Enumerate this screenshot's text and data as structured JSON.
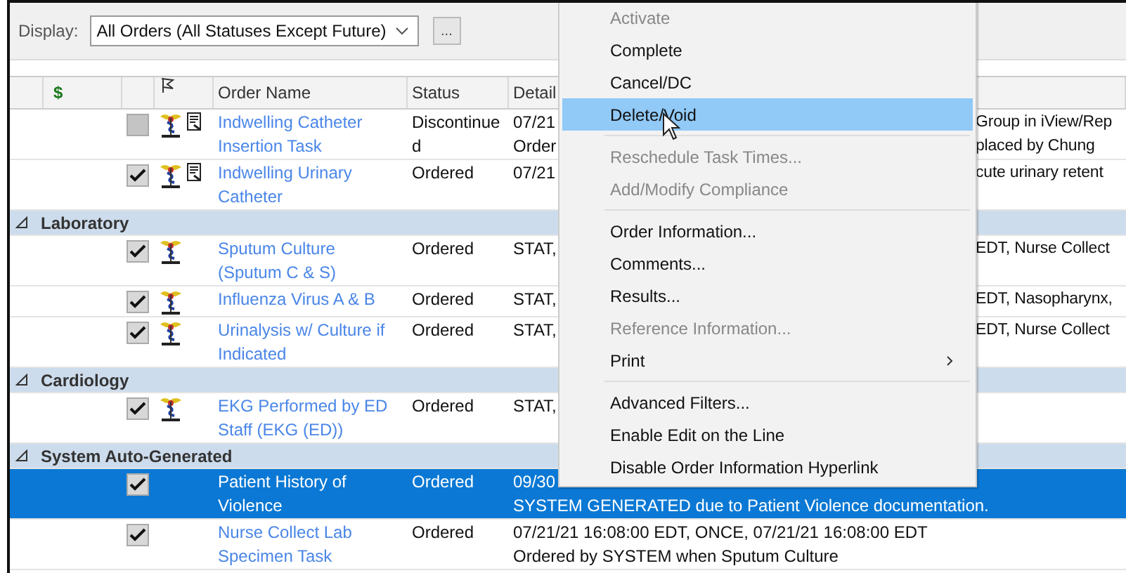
{
  "toolbar": {
    "label": "Display:",
    "dropdown": {
      "value": "All Orders (All Statuses Except Future)"
    },
    "more_button": "..."
  },
  "columns": [
    {
      "kind": "blank"
    },
    {
      "kind": "text",
      "label": "$"
    },
    {
      "kind": "blank"
    },
    {
      "kind": "flag"
    },
    {
      "kind": "text",
      "label": "Order Name"
    },
    {
      "kind": "text",
      "label": "Status"
    },
    {
      "kind": "text",
      "label": "Detail"
    }
  ],
  "rows": [
    {
      "kind": "order",
      "checked": false,
      "disabled": true,
      "caduceus": true,
      "note": true,
      "name": "Indwelling Catheter Insertion Task",
      "status": "Discontinued",
      "selected": false,
      "details": [
        {
          "left": "07/21",
          "right": "Group in iView/Rep"
        },
        {
          "left": "Order",
          "right": "placed by Chung"
        }
      ]
    },
    {
      "kind": "order",
      "checked": true,
      "disabled": false,
      "caduceus": true,
      "note": true,
      "name": "Indwelling Urinary Catheter",
      "status": "Ordered",
      "selected": false,
      "details": [
        {
          "left": "07/21",
          "right": "cute urinary retent"
        }
      ]
    },
    {
      "kind": "group",
      "label": "Laboratory",
      "expanded": true
    },
    {
      "kind": "order",
      "checked": true,
      "disabled": false,
      "caduceus": true,
      "note": false,
      "name": "Sputum Culture (Sputum C & S)",
      "status": "Ordered",
      "selected": false,
      "details": [
        {
          "left": "STAT,",
          "right": "EDT, Nurse Collect"
        }
      ]
    },
    {
      "kind": "order",
      "checked": true,
      "disabled": false,
      "caduceus": true,
      "note": false,
      "name": "Influenza Virus A & B",
      "status": "Ordered",
      "selected": false,
      "details": [
        {
          "left": "STAT,",
          "right": "EDT, Nasopharynx,"
        }
      ]
    },
    {
      "kind": "order",
      "checked": true,
      "disabled": false,
      "caduceus": true,
      "note": false,
      "name": "Urinalysis w/ Culture if Indicated",
      "status": "Ordered",
      "selected": false,
      "details": [
        {
          "left": "STAT,",
          "right": "EDT, Nurse Collect"
        }
      ]
    },
    {
      "kind": "group",
      "label": "Cardiology",
      "expanded": true
    },
    {
      "kind": "order",
      "checked": true,
      "disabled": false,
      "caduceus": true,
      "note": false,
      "name": "EKG Performed by ED Staff (EKG (ED))",
      "status": "Ordered",
      "selected": false,
      "details": [
        {
          "left": "STAT,"
        }
      ]
    },
    {
      "kind": "group",
      "label": "System Auto-Generated",
      "expanded": true
    },
    {
      "kind": "order",
      "checked": true,
      "disabled": false,
      "caduceus": false,
      "note": false,
      "name": "Patient History of Violence",
      "status": "Ordered",
      "selected": true,
      "details": [
        {
          "left": "09/30"
        },
        {
          "left": "SYSTEM GENERATED due to Patient Violence documentation."
        }
      ]
    },
    {
      "kind": "order",
      "checked": true,
      "disabled": false,
      "caduceus": false,
      "note": false,
      "name": "Nurse Collect Lab Specimen Task",
      "status": "Ordered",
      "selected": false,
      "details": [
        {
          "left": "07/21/21 16:08:00 EDT, ONCE, 07/21/21 16:08:00 EDT"
        },
        {
          "left": "Ordered by SYSTEM when Sputum Culture"
        }
      ]
    }
  ],
  "context_menu": [
    {
      "kind": "item",
      "label": "Activate",
      "disabled": true,
      "selected": false
    },
    {
      "kind": "item",
      "label": "Complete",
      "disabled": false,
      "selected": false
    },
    {
      "kind": "item",
      "label": "Cancel/DC",
      "disabled": false,
      "selected": false
    },
    {
      "kind": "item",
      "label": "Delete/Void",
      "disabled": false,
      "selected": true
    },
    {
      "kind": "separator"
    },
    {
      "kind": "item",
      "label": "Reschedule Task Times...",
      "disabled": true,
      "selected": false
    },
    {
      "kind": "item",
      "label": "Add/Modify Compliance",
      "disabled": true,
      "selected": false
    },
    {
      "kind": "separator"
    },
    {
      "kind": "item",
      "label": "Order Information...",
      "disabled": false,
      "selected": false
    },
    {
      "kind": "item",
      "label": "Comments...",
      "disabled": false,
      "selected": false
    },
    {
      "kind": "item",
      "label": "Results...",
      "disabled": false,
      "selected": false
    },
    {
      "kind": "item",
      "label": "Reference Information...",
      "disabled": true,
      "selected": false
    },
    {
      "kind": "submenu",
      "label": "Print",
      "disabled": false,
      "selected": false
    },
    {
      "kind": "separator"
    },
    {
      "kind": "item",
      "label": "Advanced Filters...",
      "disabled": false,
      "selected": false
    },
    {
      "kind": "item",
      "label": "Enable Edit on the Line",
      "disabled": false,
      "selected": false
    },
    {
      "kind": "item",
      "label": "Disable Order Information Hyperlink",
      "disabled": false,
      "selected": false
    }
  ]
}
